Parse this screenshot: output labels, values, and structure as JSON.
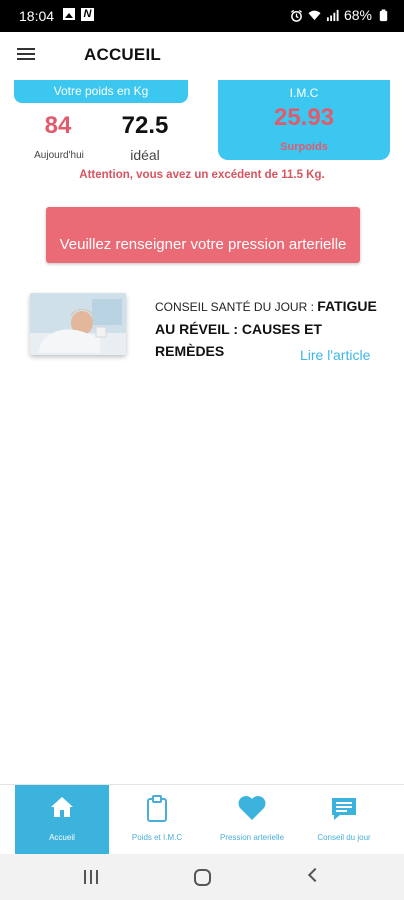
{
  "status_bar": {
    "time": "18:04",
    "battery": "68%",
    "icons": [
      "gallery-icon",
      "n-notification-icon",
      "alarm-icon",
      "wifi-icon",
      "signal-icon",
      "battery-icon"
    ]
  },
  "header": {
    "title": "ACCUEIL",
    "menu_icon": "hamburger-menu-icon"
  },
  "weight": {
    "tab_label": "Votre poids en Kg",
    "current_value": "84",
    "current_label": "Aujourd'hui",
    "ideal_value": "72.5",
    "ideal_label": "idéal"
  },
  "imc": {
    "title": "I.M.C",
    "value": "25.93",
    "status": "Surpoids"
  },
  "warning": "Attention, vous avez un excédent de 11.5 Kg.",
  "blood_pressure_prompt": "Veuillez renseigner votre pression arterielle",
  "tip": {
    "prefix": "CONSEIL SANTÉ DU JOUR : ",
    "title": "FATIGUE AU RÉVEIL : CAUSES ET REMÈDES",
    "link": "Lire l'article",
    "thumbnail": "tired-person-photo"
  },
  "bottom_nav": {
    "items": [
      {
        "label": "Accueil",
        "icon": "home-icon",
        "active": true
      },
      {
        "label": "Poids et I.M.C",
        "icon": "clipboard-icon",
        "active": false
      },
      {
        "label": "Pression arterielle",
        "icon": "heart-icon",
        "active": false
      },
      {
        "label": "Conseil du jour",
        "icon": "chat-message-icon",
        "active": false
      }
    ]
  },
  "colors": {
    "accent_blue": "#3cc7f0",
    "alert_red": "#e05b6c",
    "button_red": "#ea6b76",
    "link_blue": "#3cb6e6"
  }
}
